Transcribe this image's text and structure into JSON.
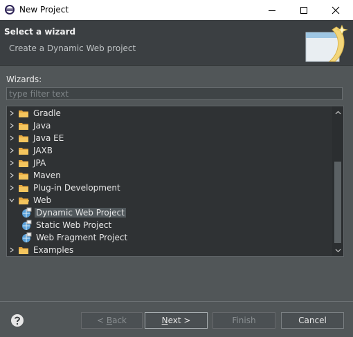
{
  "window": {
    "title": "New Project"
  },
  "header": {
    "title": "Select a wizard",
    "description": "Create a Dynamic Web project"
  },
  "filter": {
    "label": "Wizards:",
    "placeholder": "type filter text",
    "value": ""
  },
  "tree": {
    "items": [
      {
        "label": "Gradle",
        "type": "folder",
        "expanded": false,
        "level": 0
      },
      {
        "label": "Java",
        "type": "folder",
        "expanded": false,
        "level": 0
      },
      {
        "label": "Java EE",
        "type": "folder",
        "expanded": false,
        "level": 0
      },
      {
        "label": "JAXB",
        "type": "folder",
        "expanded": false,
        "level": 0
      },
      {
        "label": "JPA",
        "type": "folder",
        "expanded": false,
        "level": 0
      },
      {
        "label": "Maven",
        "type": "folder",
        "expanded": false,
        "level": 0
      },
      {
        "label": "Plug-in Development",
        "type": "folder",
        "expanded": false,
        "level": 0
      },
      {
        "label": "Web",
        "type": "folder",
        "expanded": true,
        "level": 0
      },
      {
        "label": "Dynamic Web Project",
        "type": "wizard",
        "selected": true,
        "level": 1
      },
      {
        "label": "Static Web Project",
        "type": "wizard",
        "level": 1
      },
      {
        "label": "Web Fragment Project",
        "type": "wizard",
        "level": 1
      },
      {
        "label": "Examples",
        "type": "folder",
        "expanded": false,
        "level": 0
      }
    ]
  },
  "buttons": {
    "back": {
      "prefix": "< ",
      "mnemonic": "B",
      "rest": "ack",
      "enabled": false
    },
    "next": {
      "mnemonic": "N",
      "rest": "ext >",
      "enabled": true
    },
    "finish": {
      "label": "Finish",
      "enabled": false
    },
    "cancel": {
      "label": "Cancel",
      "enabled": true
    }
  },
  "colors": {
    "background": "#515658",
    "tree_background": "#2f3234",
    "folder": "#e8a93f",
    "selection": "#51585c"
  }
}
